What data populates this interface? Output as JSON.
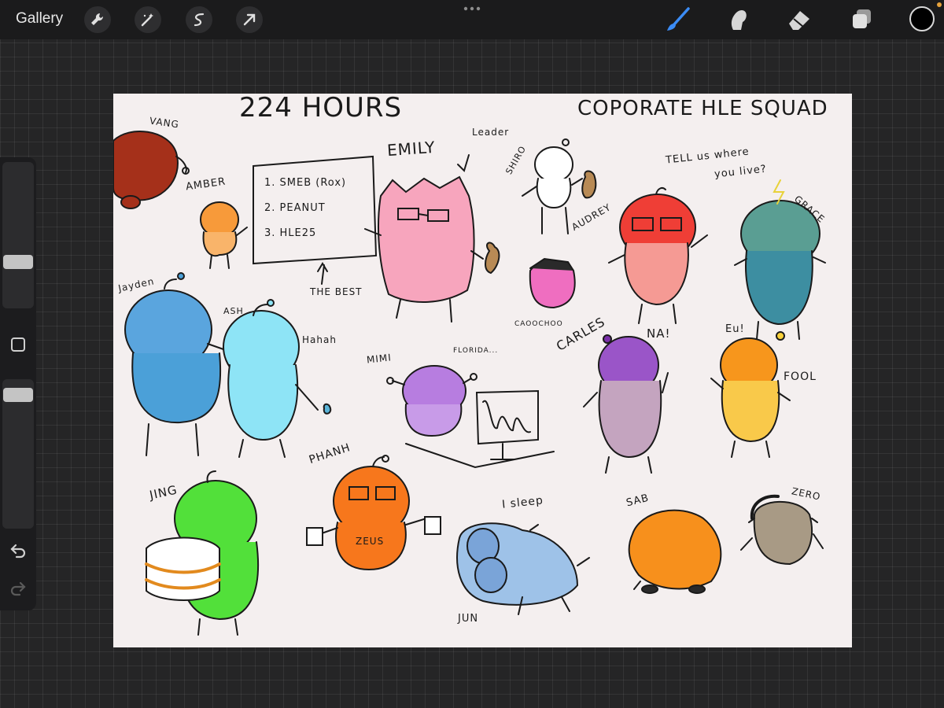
{
  "toolbar": {
    "gallery_label": "Gallery",
    "left_tools": [
      {
        "icon": "wrench-icon",
        "name": "Actions"
      },
      {
        "icon": "magic-wand-icon",
        "name": "Adjustments"
      },
      {
        "icon": "selection-icon",
        "name": "Selection"
      },
      {
        "icon": "transform-arrow-icon",
        "name": "Transform"
      }
    ],
    "right_tools": [
      {
        "icon": "brush-icon",
        "name": "Brush",
        "active": true,
        "color": "#3b8cf5"
      },
      {
        "icon": "smudge-icon",
        "name": "Smudge"
      },
      {
        "icon": "eraser-icon",
        "name": "Eraser"
      },
      {
        "icon": "layers-icon",
        "name": "Layers"
      }
    ],
    "current_color": "#000000"
  },
  "sidebar": {
    "undo_icon": "undo-icon",
    "redo_icon": "redo-icon",
    "modify_icon": "square-icon"
  },
  "canvas": {
    "title_left": "224 HOURS",
    "title_right": "COPORATE HLE SQUAD",
    "board_items": [
      "1. SMEB (Rox)",
      "2. PEANUT",
      "3. HLE25"
    ],
    "board_caption": "THE BEST",
    "labels": {
      "vang": "VANG",
      "amber": "AMBER",
      "emily": "EMILY",
      "leader": "Leader",
      "shiro": "SHIRO",
      "tell": "TELL us where",
      "tell2": "you live?",
      "audrey": "AUDREY",
      "grace": "GRACE",
      "caoochoo": "CAOOCHOO",
      "jayden": "Jayden",
      "ash": "ASH",
      "hahah": "Hahah",
      "mimi": "MIMI",
      "florida": "FLORIDA...",
      "carles": "CARLES",
      "na": "NA!",
      "eu": "Eu!",
      "fool": "FOOL",
      "jing": "JING",
      "phanh": "PHANH",
      "zeus": "ZEUS",
      "isleep": "I sleep",
      "jun": "JUN",
      "sab": "SAB",
      "zero": "ZERO"
    }
  }
}
